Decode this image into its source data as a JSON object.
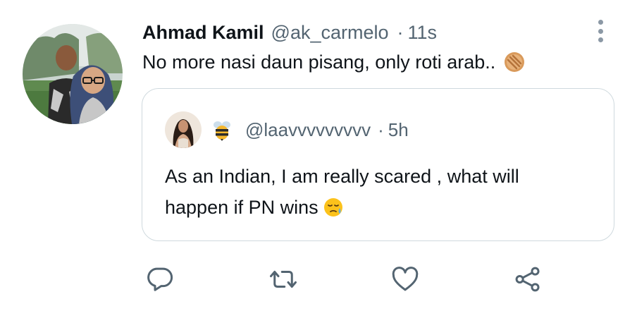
{
  "tweet": {
    "author": {
      "display_name": "Ahmad Kamil",
      "handle": "@ak_carmelo"
    },
    "separator": "·",
    "time": "11s",
    "text": "No more nasi daun pisang, only roti arab..",
    "text_emoji": "cookie-emoji",
    "more_icon": "more-vertical-icon"
  },
  "quoted_tweet": {
    "badge_icon": "bee-emoji",
    "handle": "@laavvvvvvvvv",
    "separator": "·",
    "time": "5h",
    "text_line1": "As an Indian, I am really scared , what will",
    "text_line2": "happen if PN wins",
    "text_emoji": "sleepy-face-emoji"
  },
  "actions": {
    "reply_icon": "reply-icon",
    "retweet_icon": "retweet-icon",
    "like_icon": "heart-icon",
    "share_icon": "share-icon"
  },
  "colors": {
    "primary_text": "#0f1419",
    "secondary_text": "#536471",
    "border": "#cfd9de",
    "icon": "#536471"
  }
}
